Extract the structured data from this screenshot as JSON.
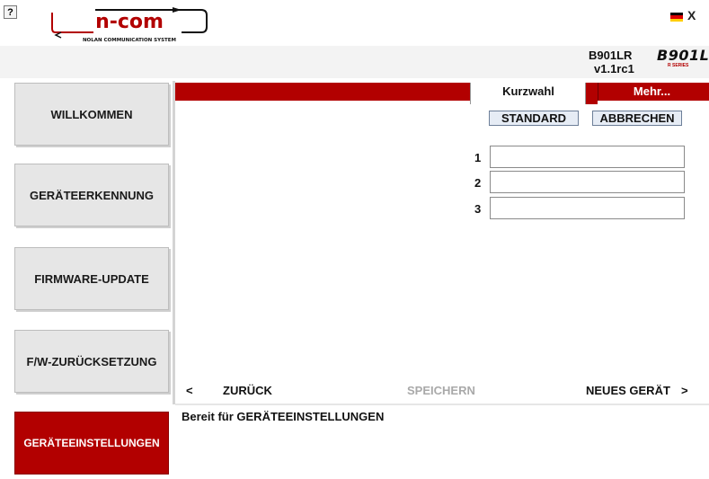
{
  "header": {
    "help_label": "?",
    "logo_text": "n-com",
    "logo_tagline": "NOLAN COMMUNICATION SYSTEM",
    "close_label": "X",
    "language_flag": "german-flag"
  },
  "device": {
    "model": "B901LR",
    "version": "v1.1rc1",
    "series_logo_text": "B901L",
    "series_logo_sub": "R SERIES"
  },
  "sidebar": {
    "items": [
      {
        "label": "WILLKOMMEN"
      },
      {
        "label": "GERÄTEERKENNUNG"
      },
      {
        "label": "FIRMWARE-UPDATE"
      },
      {
        "label": "F/W-ZURÜCKSETZUNG"
      },
      {
        "label": "GERÄTEEINSTELLUNGEN"
      }
    ]
  },
  "tabs": {
    "active": "Kurzwahl",
    "more": "Mehr..."
  },
  "speed_dial": {
    "standard_label": "STANDARD",
    "cancel_label": "ABBRECHEN",
    "rows": [
      {
        "number": "1",
        "value": ""
      },
      {
        "number": "2",
        "value": ""
      },
      {
        "number": "3",
        "value": ""
      }
    ]
  },
  "nav": {
    "back_arrow": "<",
    "back_label": "ZURÜCK",
    "save_label": "SPEICHERN",
    "new_device_label": "NEUES GERÄT",
    "forward_arrow": ">"
  },
  "status": {
    "text": "Bereit für GERÄTEEINSTELLUNGEN"
  },
  "colors": {
    "accent_red": "#b20000",
    "sidebar_gray": "#e6e6e6"
  }
}
